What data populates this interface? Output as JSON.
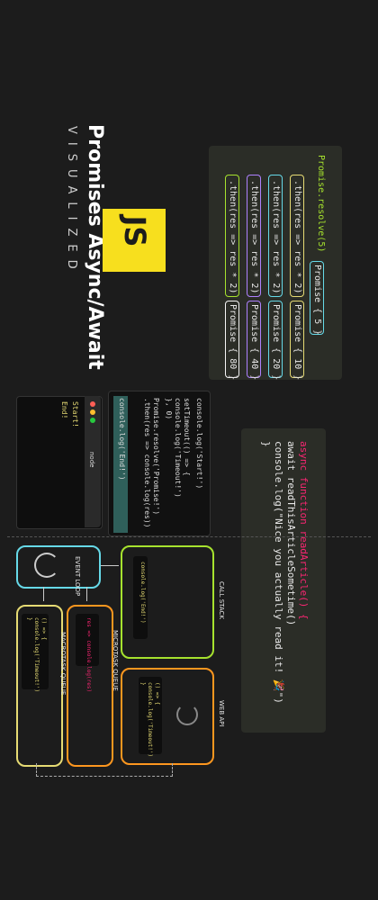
{
  "title": {
    "main": "Promises Async/Await",
    "sub": "VISUALIZED",
    "logo_text": "JS"
  },
  "colors": {
    "background": "#1c1c1c",
    "js_yellow": "#f7df1e",
    "green": "#a6e22e",
    "pink": "#f92672",
    "cyan": "#66d9e8",
    "yellow": "#e6db74",
    "orange": "#fd971f"
  },
  "promise_chain": {
    "start_code": "Promise.resolve(5)",
    "then_code": ".then(res => res * 2)",
    "results": [
      "Promise { 5 }",
      "Promise { 10 }",
      "Promise { 20 }",
      "Promise { 40 }",
      "Promise { 80 }"
    ]
  },
  "async_code": {
    "lines": [
      "async function readArticle() {",
      "  await readThisArticleSometime()",
      "  console.log(\"Nice you actually read it! 🎉\")",
      "}"
    ]
  },
  "event_loop": {
    "code_lines": [
      "console.log('Start!')",
      "setTimeout(() => {",
      "  console.log('Timeout!')",
      "}, 0)",
      "Promise.resolve('Promise!')",
      "  .then(res => console.log(res))",
      "console.log('End!')"
    ],
    "node_title": "node",
    "output_lines": [
      "Start!",
      "End!"
    ],
    "call_stack_label": "CALL STACK",
    "call_stack_item": "console.log('End!')",
    "web_api_label": "WEB API",
    "web_api_item_lines": [
      "() => {",
      "  console.log('Timeout!')",
      "}"
    ],
    "event_loop_label": "EVENT LOOP",
    "microtask_label": "MICROTASK QUEUE",
    "microtask_item": "res => console.log(res)",
    "macrotask_label": "MACROTASK QUEUE",
    "macrotask_item_lines": [
      "() => {",
      "  console.log('Timeout!')",
      "}"
    ]
  }
}
